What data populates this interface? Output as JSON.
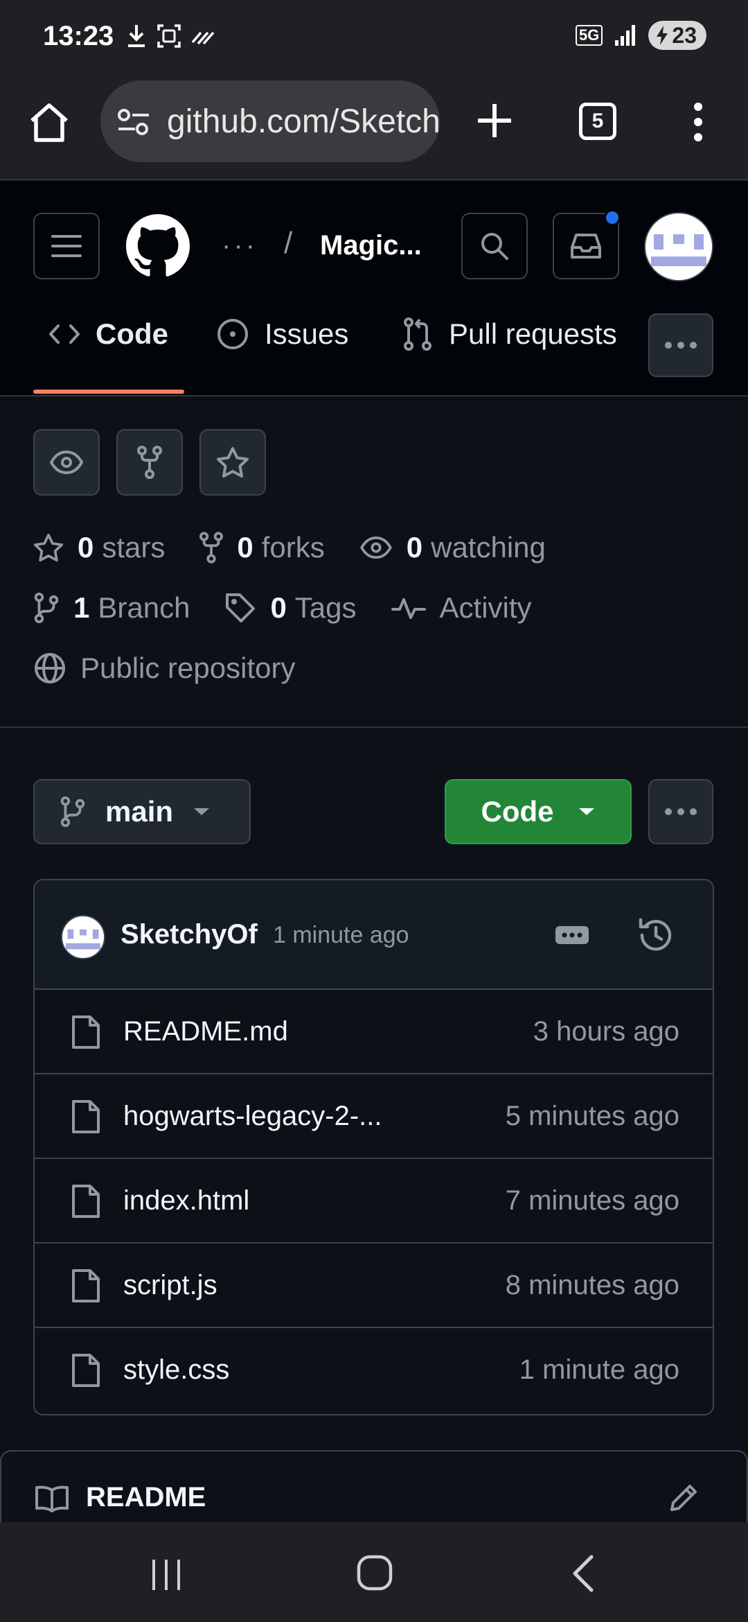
{
  "status_bar": {
    "time": "13:23",
    "network": "5G",
    "battery": "23"
  },
  "browser": {
    "url": "github.com/SketchyOf",
    "tab_count": "5"
  },
  "header": {
    "breadcrumb_ellipsis": "···",
    "breadcrumb_separator": "/",
    "repo_name": "Magic..."
  },
  "nav_tabs": [
    {
      "label": "Code"
    },
    {
      "label": "Issues"
    },
    {
      "label": "Pull requests"
    }
  ],
  "repo_meta": {
    "stars_count": "0",
    "stars_label": "stars",
    "forks_count": "0",
    "forks_label": "forks",
    "watching_count": "0",
    "watching_label": "watching",
    "branch_count": "1",
    "branch_label": "Branch",
    "tags_count": "0",
    "tags_label": "Tags",
    "activity_label": "Activity",
    "visibility_label": "Public repository"
  },
  "branch_selector": {
    "label": "main"
  },
  "code_button": {
    "label": "Code"
  },
  "latest_commit": {
    "author": "SketchyOf",
    "time": "1 minute ago"
  },
  "files": [
    {
      "name": "README.md",
      "time": "3 hours ago"
    },
    {
      "name": "hogwarts-legacy-2-...",
      "time": "5 minutes ago"
    },
    {
      "name": "index.html",
      "time": "7 minutes ago"
    },
    {
      "name": "script.js",
      "time": "8 minutes ago"
    },
    {
      "name": "style.css",
      "time": "1 minute ago"
    }
  ],
  "readme": {
    "title": "README"
  },
  "colors": {
    "accent_underline": "#f78166",
    "code_button": "#238636",
    "notification_dot": "#1f6feb"
  }
}
